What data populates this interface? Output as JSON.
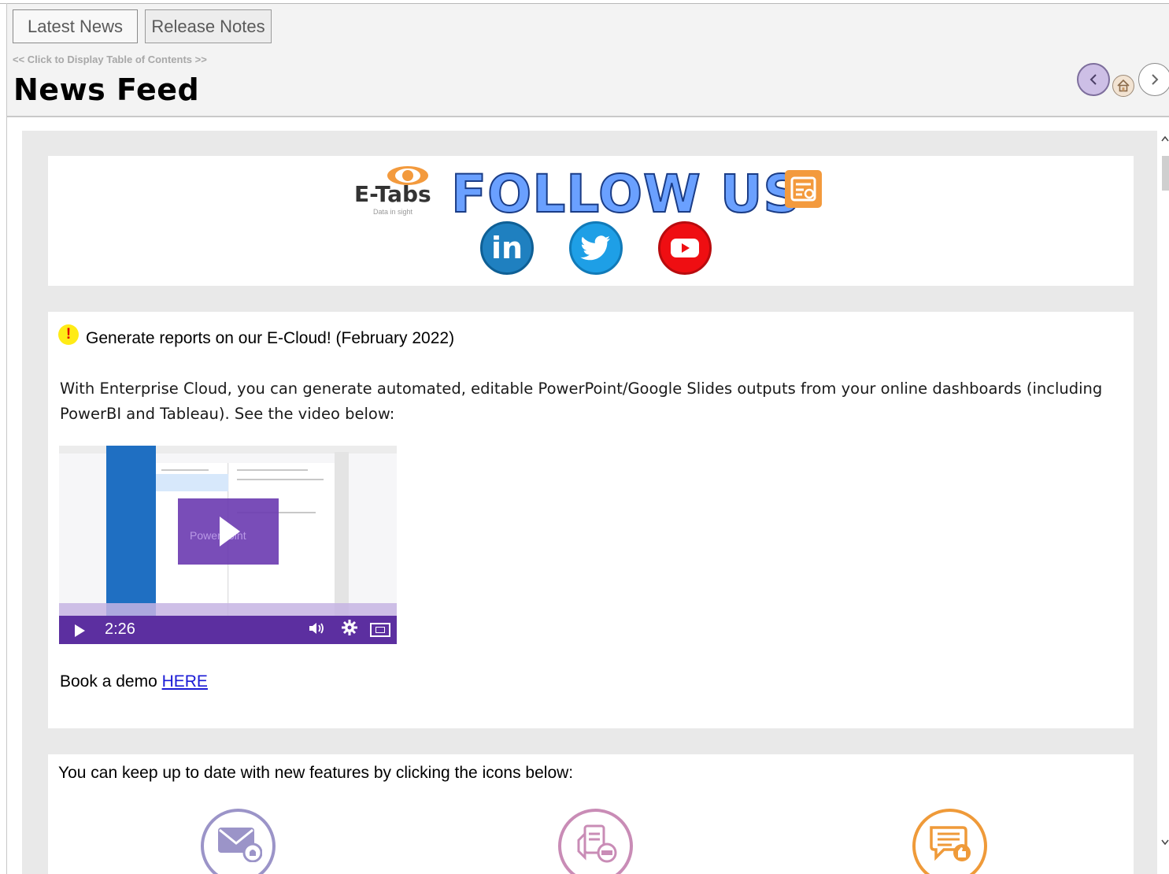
{
  "tabs": [
    {
      "label": "Latest News",
      "active": true
    },
    {
      "label": "Release Notes",
      "active": false
    }
  ],
  "header": {
    "toc_link": "<< Click to Display Table of Contents >>",
    "title": "News Feed",
    "nav": {
      "prev_icon": "chevron-left-icon",
      "home_icon": "home-icon",
      "next_icon": "chevron-right-icon"
    }
  },
  "follow": {
    "logo_text": "E-Tabs",
    "logo_tagline": "Data in sight",
    "title": "FOLLOW US",
    "social": [
      {
        "name": "LinkedIn",
        "icon": "linkedin-icon",
        "glyph": "in",
        "color": "#1f80c0"
      },
      {
        "name": "Twitter",
        "icon": "twitter-icon",
        "color": "#1e9fe6"
      },
      {
        "name": "YouTube",
        "icon": "youtube-icon",
        "color": "#ef0e12"
      }
    ]
  },
  "news": {
    "alert_glyph": "!",
    "heading": "Generate reports on our E-Cloud! (February 2022)",
    "body": "With Enterprise Cloud, you can generate automated, editable PowerPoint/Google Slides outputs from your online dashboards (including PowerBI and Tableau). See the video below:",
    "video": {
      "duration": "2:26",
      "overlay_text": "PowerPoint"
    },
    "book_demo_prefix": "Book a demo ",
    "book_demo_link": "HERE"
  },
  "features": {
    "text": "You can keep up to date with new features by clicking the icons below:",
    "icons": [
      {
        "name": "email-notification-icon",
        "color": "#9b94c8"
      },
      {
        "name": "release-notes-icon",
        "color": "#c98cb6"
      },
      {
        "name": "feedback-icon",
        "color": "#ef9a39"
      }
    ]
  },
  "colors": {
    "accent_purple": "#5c2fa0",
    "link_blue": "#1a1ad6",
    "panel_bg": "#e9e9e9"
  }
}
